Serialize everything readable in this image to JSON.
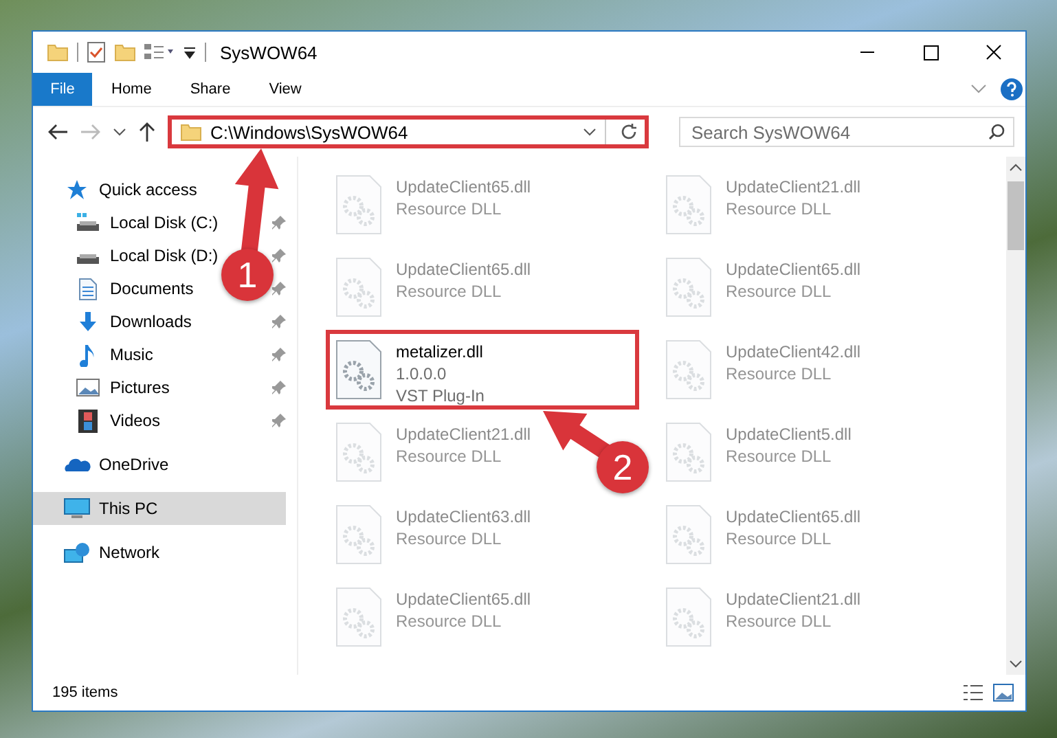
{
  "window": {
    "title": "SysWOW64"
  },
  "ribbon": {
    "tabs": [
      {
        "label": "File",
        "kind": "file",
        "selected": false
      },
      {
        "label": "Home",
        "kind": "tab",
        "selected": false
      },
      {
        "label": "Share",
        "kind": "tab",
        "selected": false
      },
      {
        "label": "View",
        "kind": "tab",
        "selected": false
      }
    ]
  },
  "address_bar": {
    "path": "C:\\Windows\\SysWOW64",
    "highlighted": true
  },
  "search": {
    "placeholder": "Search SysWOW64"
  },
  "sidebar": {
    "items": [
      {
        "label": "Quick access",
        "kind": "star",
        "selected": false,
        "children": [
          {
            "label": "Local Disk (C:)",
            "kind": "drive-c",
            "pinned": true,
            "selected": false
          },
          {
            "label": "Local Disk (D:)",
            "kind": "drive",
            "pinned": true,
            "selected": false
          },
          {
            "label": "Documents",
            "kind": "documents",
            "pinned": true,
            "selected": false
          },
          {
            "label": "Downloads",
            "kind": "downloads",
            "pinned": true,
            "selected": false
          },
          {
            "label": "Music",
            "kind": "music",
            "pinned": true,
            "selected": false
          },
          {
            "label": "Pictures",
            "kind": "pictures",
            "pinned": true,
            "selected": false
          },
          {
            "label": "Videos",
            "kind": "videos",
            "pinned": true,
            "selected": false
          }
        ]
      },
      {
        "label": "OneDrive",
        "kind": "cloud",
        "selected": false
      },
      {
        "label": "This PC",
        "kind": "pc",
        "selected": true
      },
      {
        "label": "Network",
        "kind": "network",
        "selected": false
      }
    ]
  },
  "files": [
    {
      "name": "UpdateClient65.dll",
      "details": [
        "Resource DLL"
      ],
      "faded": true,
      "highlighted": false
    },
    {
      "name": "UpdateClient21.dll",
      "details": [
        "Resource DLL"
      ],
      "faded": true,
      "highlighted": false
    },
    {
      "name": "UpdateClient65.dll",
      "details": [
        "Resource DLL"
      ],
      "faded": true,
      "highlighted": false
    },
    {
      "name": "UpdateClient65.dll",
      "details": [
        "Resource DLL"
      ],
      "faded": true,
      "highlighted": false
    },
    {
      "name": "metalizer.dll",
      "details": [
        "1.0.0.0",
        "VST Plug-In"
      ],
      "faded": false,
      "highlighted": true
    },
    {
      "name": "UpdateClient42.dll",
      "details": [
        "Resource DLL"
      ],
      "faded": true,
      "highlighted": false
    },
    {
      "name": "UpdateClient21.dll",
      "details": [
        "Resource DLL"
      ],
      "faded": true,
      "highlighted": false
    },
    {
      "name": "UpdateClient5.dll",
      "details": [
        "Resource DLL"
      ],
      "faded": true,
      "highlighted": false
    },
    {
      "name": "UpdateClient63.dll",
      "details": [
        "Resource DLL"
      ],
      "faded": true,
      "highlighted": false
    },
    {
      "name": "UpdateClient65.dll",
      "details": [
        "Resource DLL"
      ],
      "faded": true,
      "highlighted": false
    },
    {
      "name": "UpdateClient65.dll",
      "details": [
        "Resource DLL"
      ],
      "faded": true,
      "highlighted": false
    },
    {
      "name": "UpdateClient21.dll",
      "details": [
        "Resource DLL"
      ],
      "faded": true,
      "highlighted": false
    }
  ],
  "status_bar": {
    "item_count": "195 items"
  },
  "annotations": [
    {
      "label": "1"
    },
    {
      "label": "2"
    }
  ]
}
